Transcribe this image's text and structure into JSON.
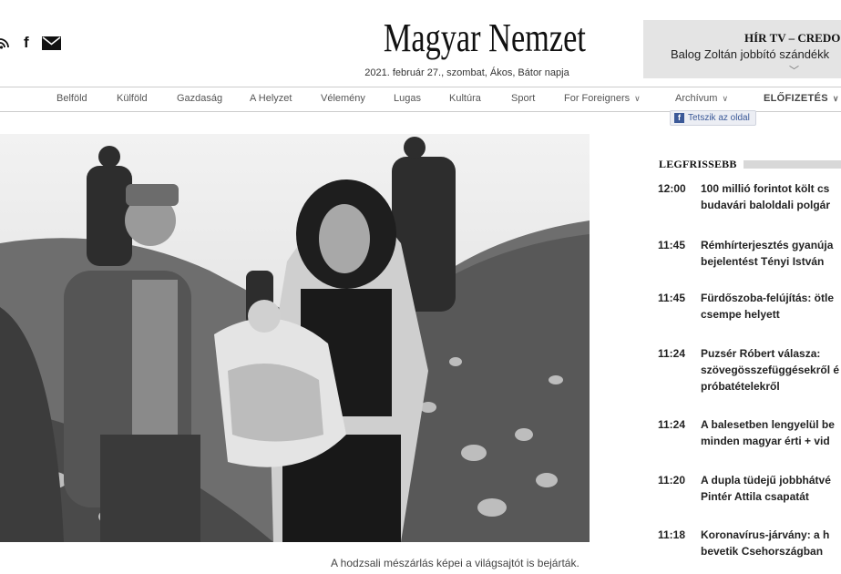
{
  "header": {
    "social_icons": [
      "rss-icon",
      "facebook-icon",
      "mail-icon"
    ],
    "facebook_glyph": "f",
    "logo": "Magyar Nemzet",
    "dateline": "2021. február 27., szombat, Ákos, Bátor napja"
  },
  "tv_widget": {
    "title": "HÍR TV – CREDO",
    "subtitle": "Balog Zoltán jobbító szándékk",
    "chevron": "﹀"
  },
  "nav": {
    "items": [
      {
        "label": "Belföld"
      },
      {
        "label": "Külföld"
      },
      {
        "label": "Gazdaság"
      },
      {
        "label": "A Helyzet"
      },
      {
        "label": "Vélemény"
      },
      {
        "label": "Lugas"
      },
      {
        "label": "Kultúra"
      },
      {
        "label": "Sport"
      },
      {
        "label": "For Foreigners",
        "chevron": "∨"
      },
      {
        "label": "Archívum",
        "chevron": "∨"
      },
      {
        "label": "ELŐFIZETÉS",
        "chevron": "∨"
      }
    ]
  },
  "article": {
    "partial_text_above": "g                                    y",
    "caption": "A hodzsali mészárlás képei a világsajtót is bejárták."
  },
  "sidebar": {
    "like_button": {
      "icon": "f",
      "label": "Tetszik az oldal"
    },
    "latest_heading": "LEGFRISSEBB",
    "news": [
      {
        "time": "12:00",
        "line1": "100 millió forintot költ cs",
        "line2": "budavári baloldali polgár"
      },
      {
        "time": "11:45",
        "line1": "Rémhírterjesztés gyanúja",
        "line2": "bejelentést Tényi István"
      },
      {
        "time": "11:45",
        "line1": "Fürdőszoba-felújítás: ötle",
        "line2": "csempe helyett"
      },
      {
        "time": "11:24",
        "line1": "Puzsér Róbert válasza:",
        "line2": "szövegösszefüggésekről é",
        "line3": "próbatételekről"
      },
      {
        "time": "11:24",
        "line1": "A balesetben lengyelül be",
        "line2": "minden magyar érti + vid"
      },
      {
        "time": "11:20",
        "line1": "A dupla tüdejű jobbhátvé",
        "line2": "Pintér Attila csapatát"
      },
      {
        "time": "11:18",
        "line1": "Koronavírus-járvány: a h",
        "line2": "bevetik Csehországban"
      }
    ]
  }
}
